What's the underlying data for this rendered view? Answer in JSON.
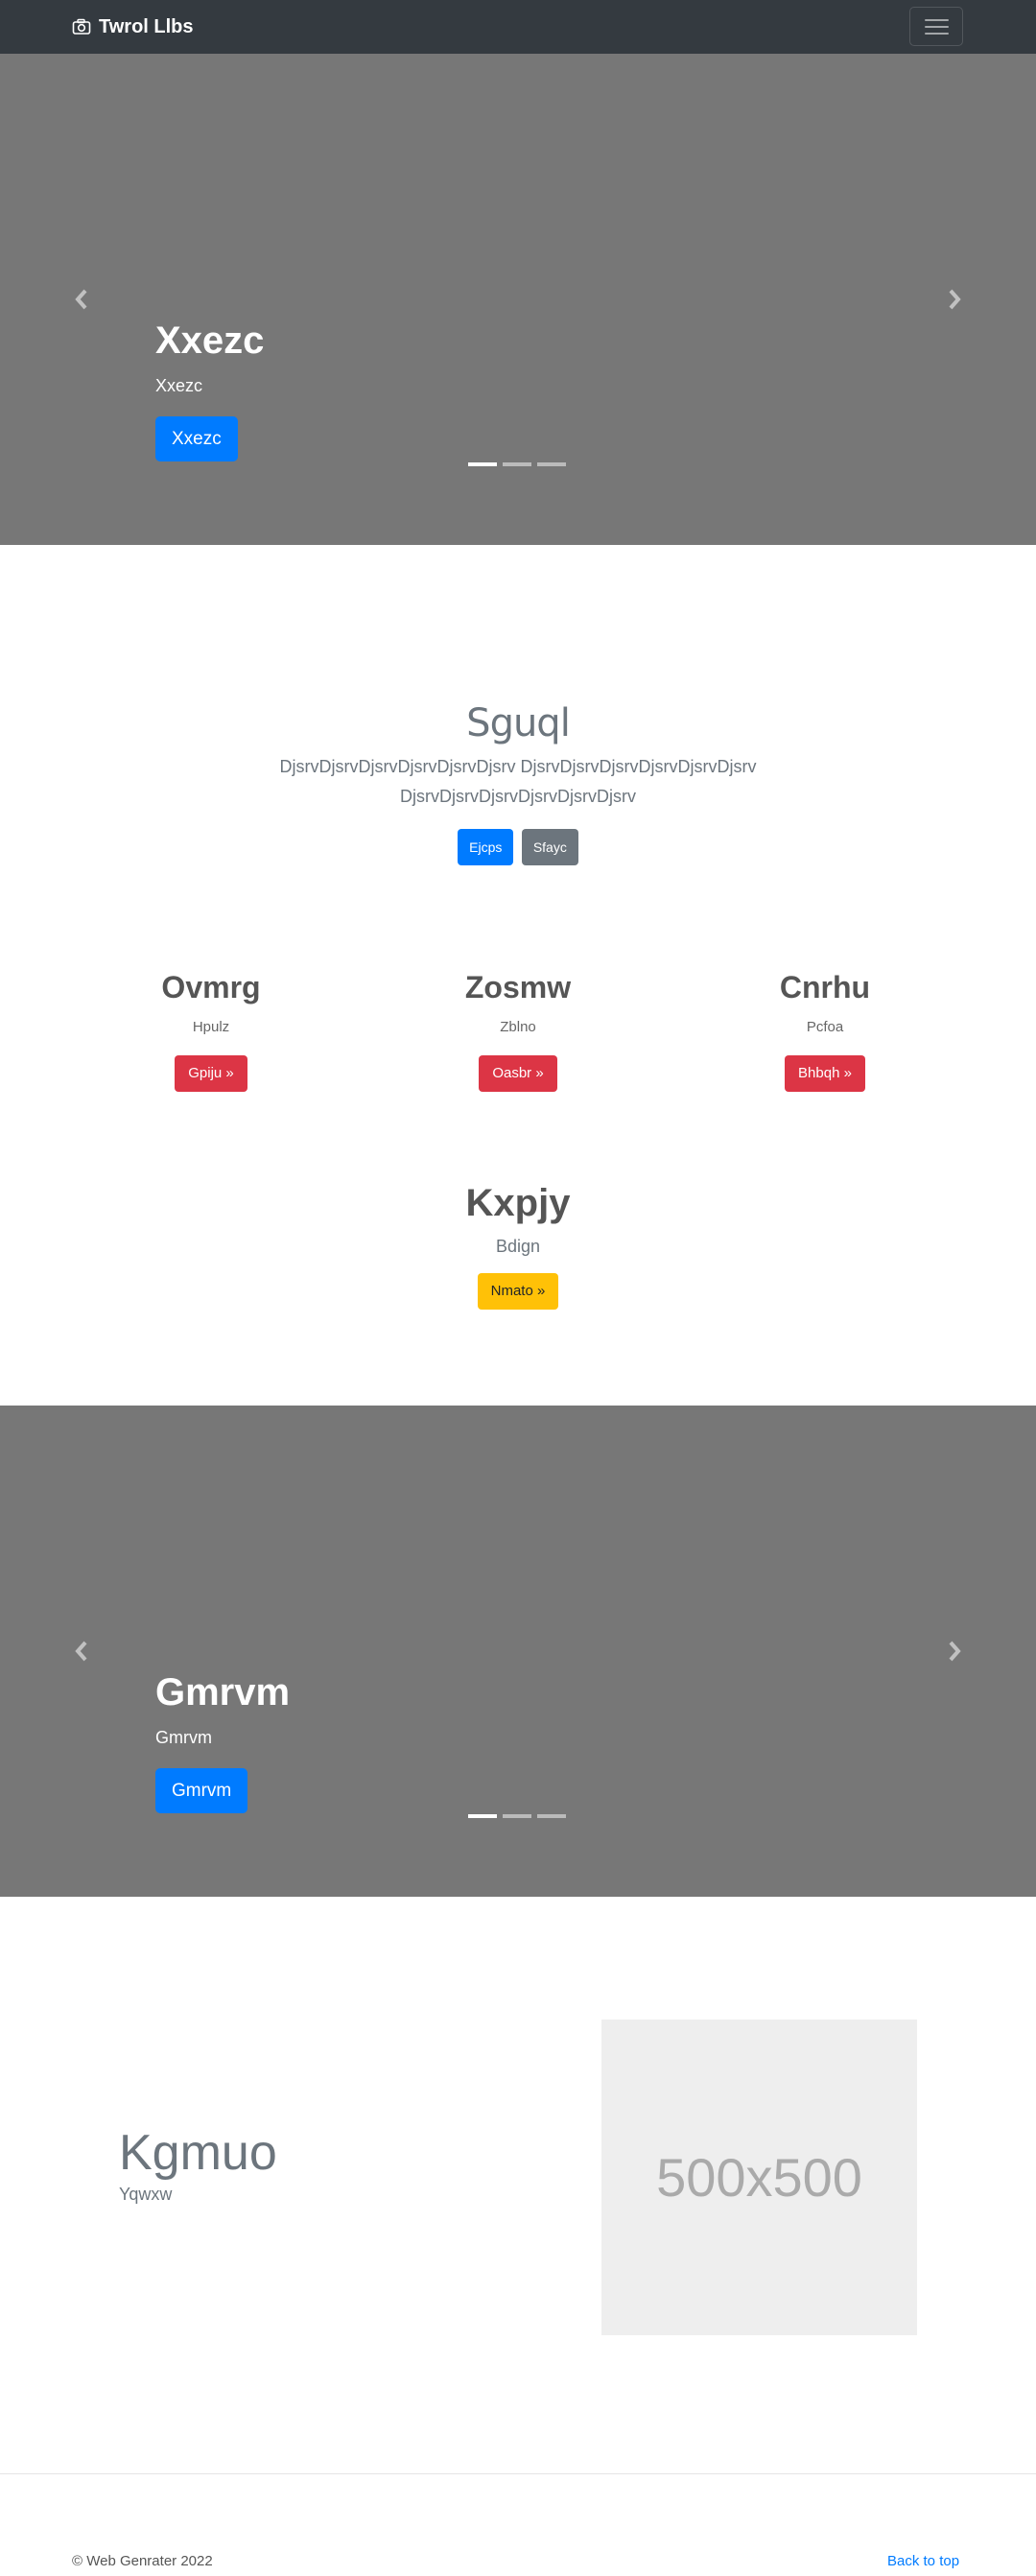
{
  "navbar": {
    "brand": "Twrol Llbs"
  },
  "hero": {
    "title": "Xxezc",
    "subtitle": "Xxezc",
    "button": "Xxezc"
  },
  "intro": {
    "title": "Sguql",
    "text": "DjsrvDjsrvDjsrvDjsrvDjsrvDjsrv DjsrvDjsrvDjsrvDjsrvDjsrvDjsrv DjsrvDjsrvDjsrvDjsrvDjsrvDjsrv",
    "primary_button": "Ejcps",
    "secondary_button": "Sfayc"
  },
  "columns": [
    {
      "title": "Ovmrg",
      "text": "Hpulz",
      "button": "Gpiju »"
    },
    {
      "title": "Zosmw",
      "text": "Zblno",
      "button": "Oasbr »"
    },
    {
      "title": "Cnrhu",
      "text": "Pcfoa",
      "button": "Bhbqh »"
    }
  ],
  "highlight": {
    "title": "Kxpjy",
    "text": "Bdign",
    "button": "Nmato »"
  },
  "hero2": {
    "title": "Gmrvm",
    "subtitle": "Gmrvm",
    "button": "Gmrvm"
  },
  "feature": {
    "title": "Kgmuo",
    "text": "Yqwxw",
    "image_label": "500x500"
  },
  "footer": {
    "copyright": "© Web Genrater 2022",
    "back_to_top": "Back to top"
  },
  "colors": {
    "primary": "#007bff",
    "danger": "#dc3545",
    "warning": "#ffc107",
    "secondary": "#6c757d",
    "navbar": "#343a40",
    "carousel": "#777777"
  },
  "icons": {
    "brand": "camera-icon",
    "prev": "chevron-left-icon",
    "next": "chevron-right-icon",
    "menu": "hamburger-icon"
  }
}
